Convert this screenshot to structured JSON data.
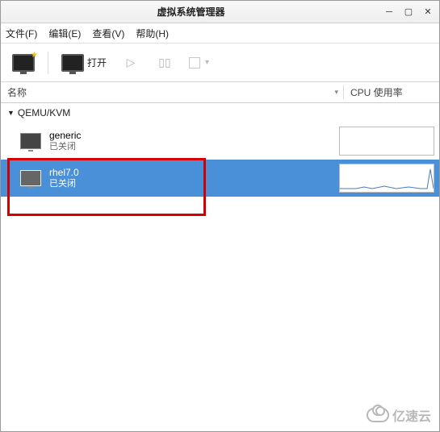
{
  "window": {
    "title": "虚拟系统管理器"
  },
  "menu": {
    "file": "文件(F)",
    "edit": "编辑(E)",
    "view": "查看(V)",
    "help": "帮助(H)"
  },
  "toolbar": {
    "open_label": "打开"
  },
  "columns": {
    "name": "名称",
    "cpu": "CPU 使用率"
  },
  "connection": {
    "label": "QEMU/KVM"
  },
  "vms": [
    {
      "name": "generic",
      "status": "已关闭",
      "selected": false
    },
    {
      "name": "rhel7.0",
      "status": "已关闭",
      "selected": true
    }
  ],
  "watermark": "亿速云"
}
